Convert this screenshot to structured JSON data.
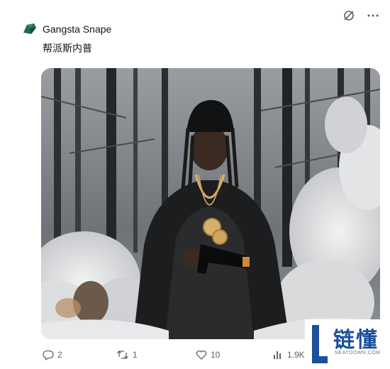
{
  "post": {
    "author_name": "Gangsta Snape",
    "text": "帮派斯内普"
  },
  "top_actions": [
    {
      "name": "grok-icon"
    },
    {
      "name": "more-icon"
    }
  ],
  "actions": {
    "replies": "2",
    "reposts": "1",
    "likes": "10",
    "views": "1.9K"
  },
  "watermark": {
    "text": "链懂",
    "subtext": "NEATDOWN.COM"
  },
  "colors": {
    "text": "#0f1419",
    "muted": "#536471",
    "watermark_blue": "#1b4f9c"
  }
}
